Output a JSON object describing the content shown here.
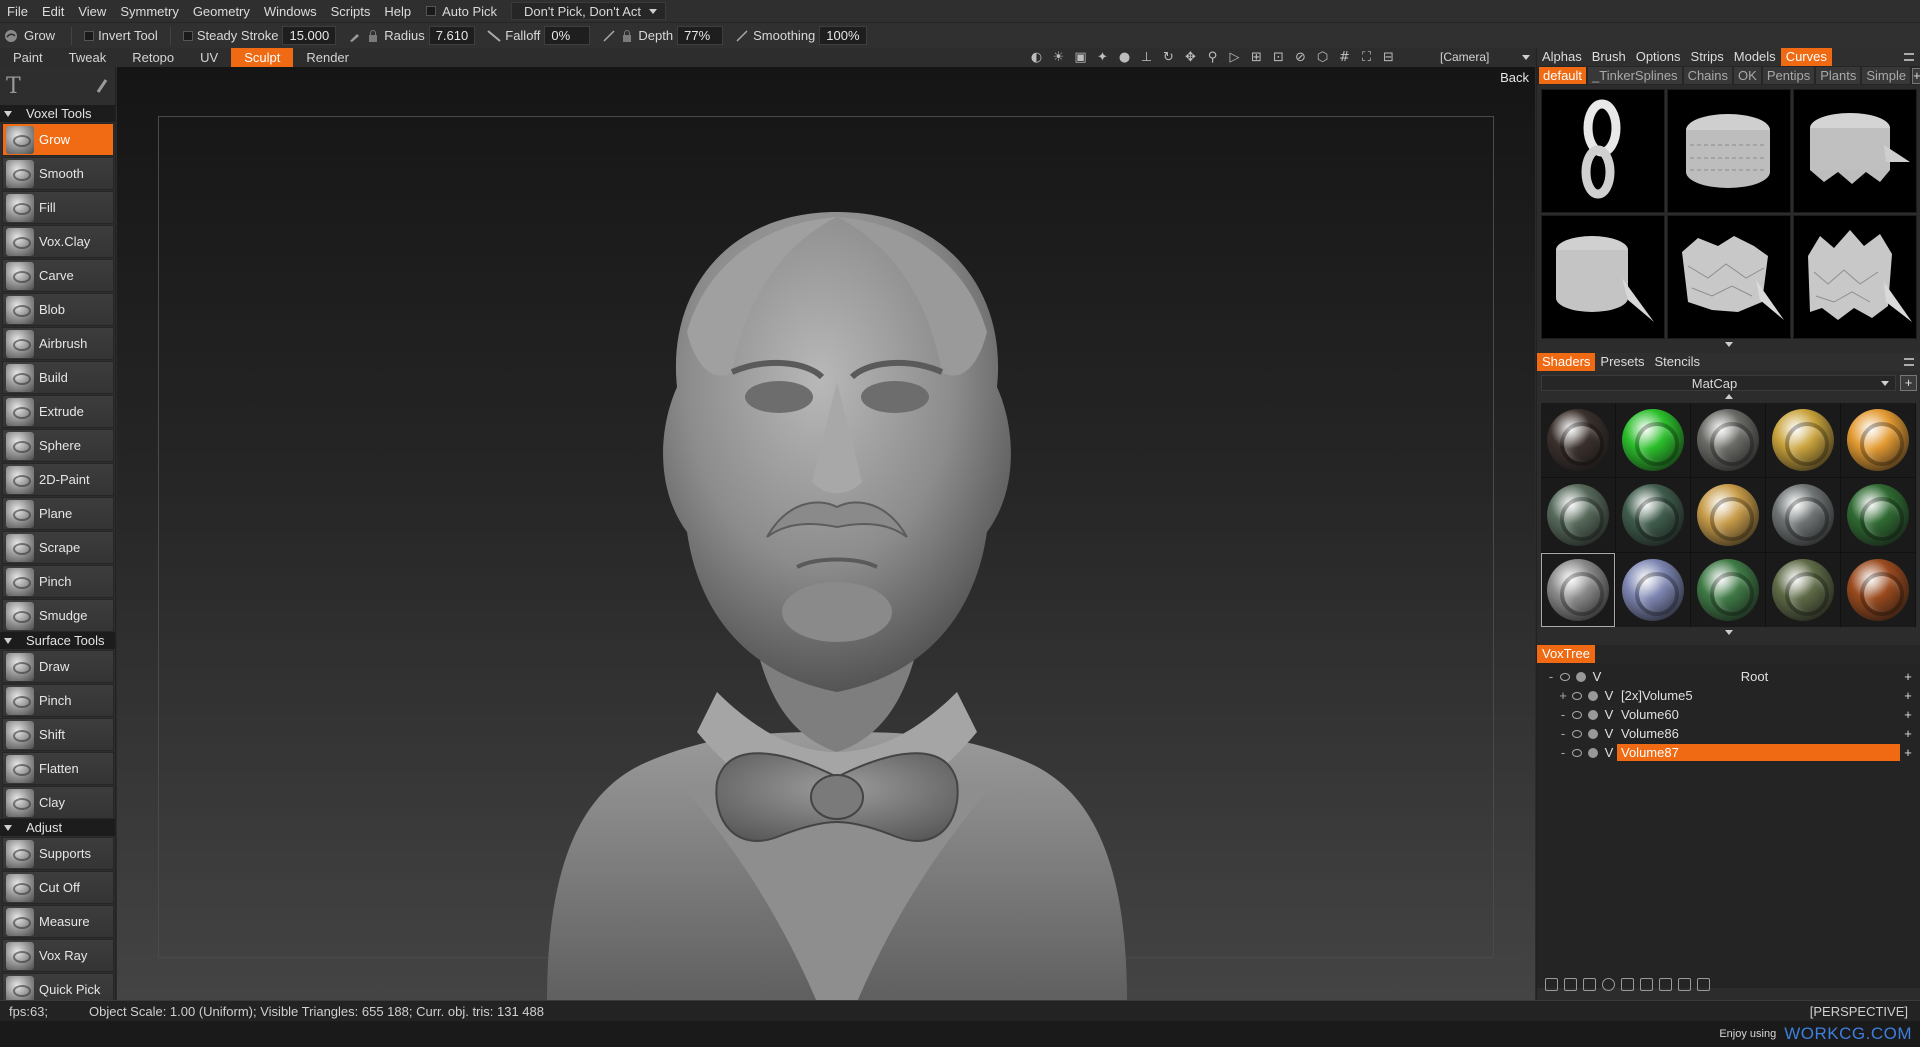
{
  "menubar": {
    "items": [
      "File",
      "Edit",
      "View",
      "Symmetry",
      "Geometry",
      "Windows",
      "Scripts",
      "Help"
    ],
    "auto_pick_label": "Auto Pick",
    "pick_mode_value": "Don't Pick, Don't Act"
  },
  "toolbar": {
    "tool_name": "Grow",
    "invert_tool_label": "Invert Tool",
    "steady_stroke_label": "Steady Stroke",
    "steady_stroke_value": "15.000",
    "radius_label": "Radius",
    "radius_value": "7.610",
    "falloff_label": "Falloff",
    "falloff_value": "0%",
    "depth_label": "Depth",
    "depth_value": "77%",
    "smoothing_label": "Smoothing",
    "smoothing_value": "100%"
  },
  "mode_tabs": [
    "Paint",
    "Tweak",
    "Retopo",
    "UV",
    "Sculpt",
    "Render"
  ],
  "active_mode": "Sculpt",
  "camera_value": "[Camera]",
  "viewport": {
    "back_label": "Back"
  },
  "left_panel": {
    "voxel_tools_header": "Voxel Tools",
    "voxel_tools": [
      "Grow",
      "Smooth",
      "Fill",
      "Vox.Clay",
      "Carve",
      "Blob",
      "Airbrush",
      "Build",
      "Extrude",
      "Sphere",
      "2D-Paint",
      "Plane",
      "Scrape",
      "Pinch",
      "Smudge"
    ],
    "active_tool": "Grow",
    "surface_tools_header": "Surface Tools",
    "surface_tools": [
      "Draw",
      "Pinch",
      "Shift",
      "Flatten",
      "Clay"
    ],
    "adjust_header": "Adjust",
    "adjust_tools": [
      "Supports",
      "Cut Off",
      "Measure",
      "Vox Ray",
      "Quick Pick"
    ]
  },
  "right_panel": {
    "top_tabs": [
      "Alphas",
      "Brush",
      "Options",
      "Strips",
      "Models",
      "Curves"
    ],
    "active_top_tab": "Curves",
    "curve_subtabs": [
      "default",
      "_TinkerSplines",
      "Chains",
      "OK",
      "Pentips",
      "Plants",
      "Simple"
    ],
    "active_curve_subtab": "default",
    "shader_tabs": [
      "Shaders",
      "Presets",
      "Stencils"
    ],
    "active_shader_tab": "Shaders",
    "shader_dropdown": "MatCap",
    "matcaps": [
      "#3a302c",
      "#2bbf2b",
      "#6a6a66",
      "#c9a33c",
      "#e39a32",
      "#56695a",
      "#3f5c4c",
      "#c79b48",
      "#6e7374",
      "#2f6a32",
      "#8a8a8a",
      "#7d86b2",
      "#3f7a46",
      "#5e6a46",
      "#9a4a1e"
    ],
    "voxtree_label": "VoxTree",
    "voxtree": [
      {
        "expand": "-",
        "name": "Root",
        "root": true
      },
      {
        "expand": "+",
        "name": "[2x]Volume5"
      },
      {
        "expand": "-",
        "name": "Volume60"
      },
      {
        "expand": "-",
        "name": "Volume86"
      },
      {
        "expand": "-",
        "name": "Volume87",
        "selected": true
      }
    ],
    "voxtree_v_label": "V",
    "voxtree_plus": "+"
  },
  "status": {
    "fps": "fps:63;",
    "info": "Object Scale: 1.00 (Uniform); Visible Triangles: 655 188; Curr. obj. tris: 131 488",
    "projection": "[PERSPECTIVE]"
  },
  "footer": {
    "enjoy": "Enjoy using",
    "brand": "WORKCG.COM"
  }
}
